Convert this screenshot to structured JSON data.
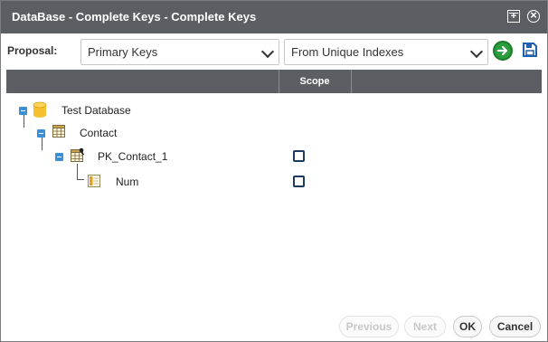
{
  "window": {
    "title": "DataBase - Complete Keys - Complete Keys"
  },
  "toolbar": {
    "proposal_label": "Proposal:",
    "proposal_value": "Primary Keys",
    "source_value": "From Unique Indexes"
  },
  "grid": {
    "columns": [
      "",
      "Scope",
      ""
    ]
  },
  "tree": {
    "database": "Test Database",
    "table": "Contact",
    "key": "PK_Contact_1",
    "column": "Num",
    "key_scope_checked": false,
    "column_scope_checked": false
  },
  "footer": {
    "previous_label": "Previous",
    "next_label": "Next",
    "ok_label": "OK",
    "cancel_label": "Cancel"
  },
  "colors": {
    "titlebar": "#5b5f63",
    "accent_blue": "#3b8fd6",
    "go_green": "#2a9d3c",
    "save_blue": "#1f5fb0"
  }
}
